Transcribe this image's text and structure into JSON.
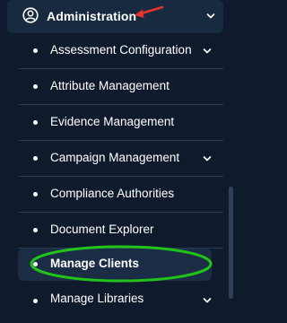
{
  "header": {
    "label": "Administration",
    "icon": "user-circle-icon"
  },
  "menu": {
    "items": [
      {
        "label": "Assessment Configuration",
        "has_chevron": true
      },
      {
        "label": "Attribute Management",
        "has_chevron": false
      },
      {
        "label": "Evidence Management",
        "has_chevron": false
      },
      {
        "label": "Campaign Management",
        "has_chevron": true
      },
      {
        "label": "Compliance Authorities",
        "has_chevron": false
      },
      {
        "label": "Document Explorer",
        "has_chevron": false
      },
      {
        "label": "Manage Clients",
        "has_chevron": false,
        "active": true
      },
      {
        "label": "Manage Libraries",
        "has_chevron": true
      }
    ]
  },
  "colors": {
    "background": "#0f1b2d",
    "header_bg": "#172a40",
    "active_bg": "#1b2d44",
    "annotation_arrow": "#e8322e",
    "annotation_oval": "#22c41a"
  }
}
